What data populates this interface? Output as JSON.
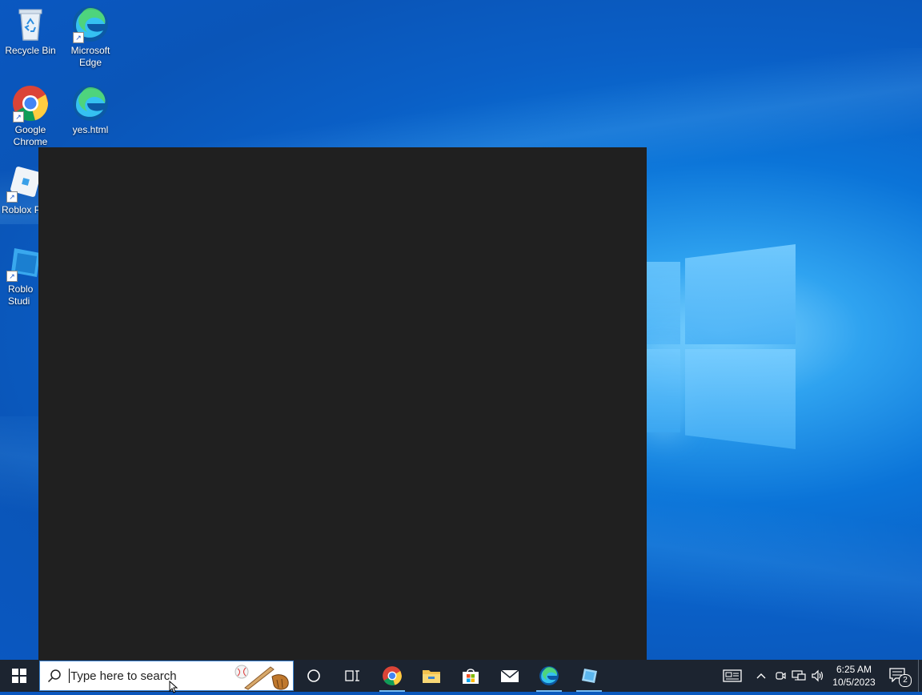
{
  "desktop": {
    "icons": [
      {
        "label": "Recycle Bin",
        "icon": "recycle-bin-icon"
      },
      {
        "label": "Microsoft Edge",
        "icon": "edge-icon"
      },
      {
        "label": "Google Chrome",
        "icon": "chrome-icon"
      },
      {
        "label": "yes.html",
        "icon": "edge-html-file-icon"
      },
      {
        "label": "Roblox P",
        "icon": "roblox-player-icon"
      },
      {
        "label": "Roblo Studi",
        "icon": "roblox-studio-icon"
      }
    ]
  },
  "taskbar": {
    "search_placeholder": "Type here to search",
    "apps": [
      {
        "name": "cortana",
        "icon": "cortana-circle-icon"
      },
      {
        "name": "task-view",
        "icon": "task-view-icon"
      },
      {
        "name": "chrome",
        "icon": "chrome-icon",
        "running": true
      },
      {
        "name": "file-explorer",
        "icon": "folder-icon"
      },
      {
        "name": "store",
        "icon": "store-bag-icon"
      },
      {
        "name": "mail",
        "icon": "mail-icon"
      },
      {
        "name": "edge",
        "icon": "edge-icon",
        "running": true
      },
      {
        "name": "roblox-studio",
        "icon": "roblox-studio-icon",
        "running": true
      }
    ],
    "tray": {
      "time": "6:25 AM",
      "date": "10/5/2023",
      "notification_count": "2"
    }
  },
  "colors": {
    "taskbar_bg": "#1c2430",
    "dark_window_bg": "#202020",
    "accent": "#0a74da"
  }
}
